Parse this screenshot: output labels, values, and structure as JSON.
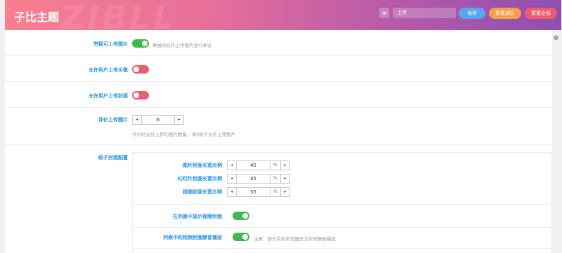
{
  "header": {
    "watermark": "ZIBLL",
    "title": "子比主题",
    "search_value": "上传",
    "save_label": "保存",
    "reset_section_label": "重置选区",
    "reset_all_label": "重置全部",
    "help_icon": "?",
    "list_icon": "≡"
  },
  "settings": [
    {
      "label": "举报可上传图片",
      "state": "on",
      "desc": "举报时允许上传图片进行举证"
    },
    {
      "label": "允许用户上传头像",
      "state": "off"
    },
    {
      "label": "允许用户上传封面",
      "state": "off"
    },
    {
      "label": "评价上传图片",
      "value": "6",
      "desc": "评价时允许上传的图片数量，填0则不允许上传图片"
    }
  ],
  "cover_config": {
    "label": "帖子封面配置",
    "ratios": [
      {
        "label": "图片封面长宽比例",
        "value": "45",
        "unit": "%"
      },
      {
        "label": "幻灯片封面长宽比例",
        "value": "45",
        "unit": "%"
      },
      {
        "label": "视频封面长宽比例",
        "value": "55",
        "unit": "%"
      }
    ],
    "show_video_label": "在列表中显示视频封面",
    "show_video_state": "on",
    "mute_label": "列表中的视频封面静音播放",
    "mute_state": "on",
    "mute_desc": "注意：部分手机浏览器无法实现静音播放"
  },
  "glyphs": {
    "prev": "◂",
    "next": "▸"
  },
  "colors": {
    "accent_blue": "#1e90e6",
    "toggle_on": "#3fb94e",
    "toggle_off": "#ee5d6d",
    "save": "#5aa7f0",
    "reset_section": "#f2a04b",
    "reset_all": "#ee5d6d"
  }
}
